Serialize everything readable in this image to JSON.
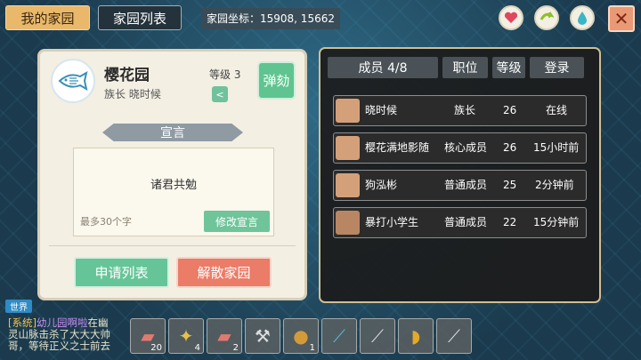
{
  "tabs": {
    "my_home": "我的家园",
    "home_list": "家园列表"
  },
  "coords": "家园坐标：15908, 15662",
  "icons": {
    "heart": "heart-icon",
    "arrow": "swap-icon",
    "drop": "water-drop-icon",
    "close": "close-icon"
  },
  "guild": {
    "name": "樱花园",
    "leader_label": "族长",
    "leader_name": "晓时候",
    "level": "等级 3",
    "impeach": "弹劾"
  },
  "declaration": {
    "title": "宣言",
    "text": "诸君共勉",
    "limit": "最多30个字",
    "modify": "修改宣言"
  },
  "actions": {
    "apply_list": "申请列表",
    "dissolve": "解散家园"
  },
  "members": {
    "header": {
      "count": "成员 4/8",
      "position": "职位",
      "level": "等级",
      "login": "登录"
    },
    "rows": [
      {
        "name": "晓时候",
        "role": "族长",
        "level": "26",
        "login": "在线"
      },
      {
        "name": "樱花满地影随",
        "role": "核心成员",
        "level": "26",
        "login": "15小时前"
      },
      {
        "name": "狗泓彬",
        "role": "普通成员",
        "level": "25",
        "login": "2分钟前"
      },
      {
        "name": "暴打小学生",
        "role": "普通成员",
        "level": "22",
        "login": "15分钟前"
      }
    ]
  },
  "chat": {
    "channel": "世界",
    "sys": "[系统]",
    "name": "幼儿园啊啦",
    "line1_rest": "在幽",
    "line2": "灵山脉击杀了大大大帅",
    "line3": "哥，等待正义之士前去"
  },
  "hotbar": [
    {
      "icon": "meat-icon",
      "count": "20"
    },
    {
      "icon": "wheat-icon",
      "count": "4"
    },
    {
      "icon": "meat-icon",
      "count": "2"
    },
    {
      "icon": "axe-icon",
      "count": ""
    },
    {
      "icon": "bag-icon",
      "count": "1"
    },
    {
      "icon": "staff-icon",
      "count": ""
    },
    {
      "icon": "sword-icon",
      "count": ""
    },
    {
      "icon": "banana-icon",
      "count": ""
    },
    {
      "icon": "blade-icon",
      "count": ""
    }
  ]
}
